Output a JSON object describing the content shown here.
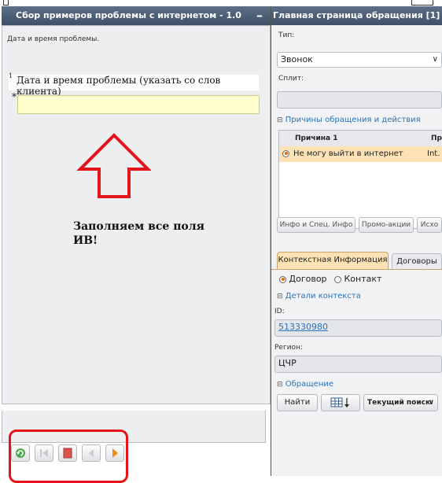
{
  "left_panel": {
    "title": "Сбор примеров проблемы с интернетом - 1.0",
    "minimize_glyph": "–",
    "subtitle": "Дата и время проблемы.",
    "question": {
      "number": "1",
      "text": "Дата и время проблемы (указать со слов клиента)",
      "required_mark": "*",
      "answer_value": ""
    },
    "annotation_line1": "Заполняем все поля",
    "annotation_line2": "ИВ!",
    "annotation_color": "#e3141a",
    "nav_icons": [
      "refresh-icon",
      "first-page-icon",
      "stop-icon",
      "previous-icon",
      "next-icon"
    ]
  },
  "right_panel": {
    "title": "Главная страница обращения [1]",
    "type_label": "Тип:",
    "type_value": "Звонок",
    "split_label": "Сплит:",
    "split_value": "",
    "reasons_section": "Причины обращения и действия",
    "reasons_table": {
      "headers": [
        "Причина 1",
        "Пр"
      ],
      "rows": [
        {
          "reason": "Не могу выйти в интернет",
          "col2": "Int."
        }
      ]
    },
    "buttons": [
      "Инфо и Спец. Инфо",
      "Промо-акции",
      "Исхо"
    ],
    "tabs": [
      "Контекстная Информация",
      "Договоры"
    ],
    "radio_options": [
      "Договор",
      "Контакт"
    ],
    "context_details_section": "Детали контекста",
    "id_label": "ID:",
    "id_value": "513330980",
    "region_label": "Регион:",
    "region_value": "ЦЧР",
    "appeal_section": "Обращение",
    "find_button": "Найти",
    "search_mode": "Текущий поиск",
    "accent_color": "#2a73b8",
    "selected_row_color": "#fde2b5"
  }
}
